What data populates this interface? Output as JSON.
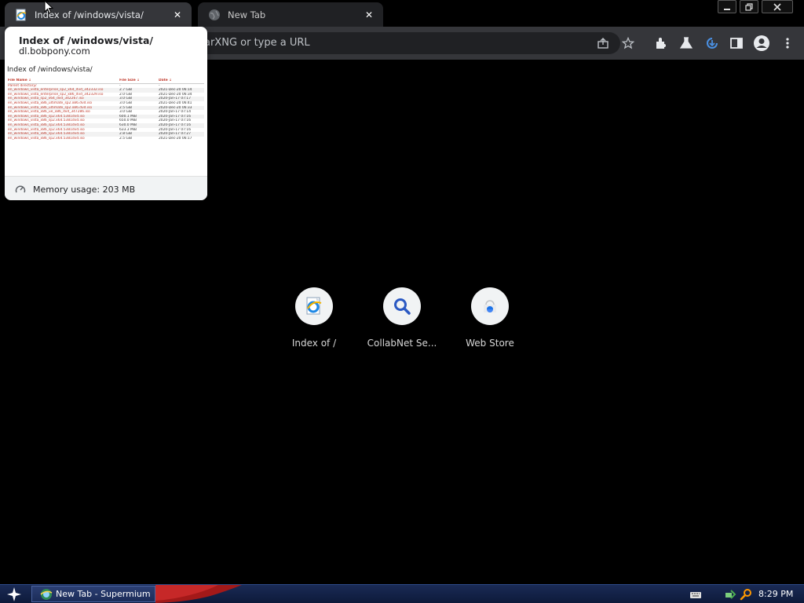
{
  "tabs": [
    {
      "title": "Index of /windows/vista/",
      "icon": "ie-page-icon",
      "active": true
    },
    {
      "title": "New Tab",
      "icon": "globe-icon",
      "active": false
    }
  ],
  "window_controls": {
    "minimize": "minimize-icon",
    "restore": "restore-icon",
    "close": "close-icon"
  },
  "omnibox": {
    "placeholder": "arXNG or type a URL"
  },
  "toolbar_icons": [
    "share-icon",
    "star-icon",
    "extensions-icon",
    "flask-icon",
    "download-icon",
    "side-panel-icon",
    "profile-icon",
    "menu-icon"
  ],
  "hover_card": {
    "title": "Index of /windows/vista/",
    "domain": "dl.bobpony.com",
    "memory": "Memory usage: 203 MB",
    "preview": {
      "heading": "Index of /windows/vista/",
      "columns": [
        "File Name ↓",
        "File Size ↓",
        "Date ↓"
      ],
      "rows": [
        [
          "Parent directory/",
          "-",
          "-"
        ],
        [
          "en_windows_vista_enterprise_sp2_x64_dvd_342332.iso",
          "2.7 GiB",
          "2021-Dec-20 06:14"
        ],
        [
          "en_windows_vista_enterprise_sp2_x86_dvd_342329.iso",
          "2.0 GiB",
          "2021-Dec-20 06:34"
        ],
        [
          "en_windows_vista_sp2_x64_dvd_342267.iso",
          "3.0 GiB",
          "2020-Jan-17 07:17"
        ],
        [
          "en_windows_vista_x86_ultimate_sp2.x86.dvd.iso",
          "3.0 GiB",
          "2021-Dec-20 06:41"
        ],
        [
          "en_windows_vista_x86_ultimate_sp2.x86.dvd.iso",
          "2.5 GiB",
          "2020-Dec-20 06:33"
        ],
        [
          "en_windows_vista_x86_ue_x86_dvd_347286.iso",
          "3.0 GiB",
          "2020-Jan-17 07:14"
        ],
        [
          "en_windows_vista_x86_sp2.x64.5381dvd.iso",
          "600.1 MiB",
          "2020-Jan-17 07:16"
        ],
        [
          "en_windows_vista_x86_sp2.x64.5381dvd.iso",
          "650.0 MiB",
          "2020-Jan-17 07:16"
        ],
        [
          "en_windows_vista_x86_sp2.x64.5381dvd.iso",
          "630.0 MiB",
          "2020-Jan-17 07:16"
        ],
        [
          "en_windows_vista_x86_sp2.x64.5381dvd.iso",
          "633.3 MiB",
          "2020-Jan-17 07:16"
        ],
        [
          "en_windows_vista_x86_sp2.x64.5381dvd.iso",
          "2.8 GiB",
          "2020-Jan-17 07:27"
        ],
        [
          "en_windows_vista_x86_sp2.x64.5381dvd.iso",
          "2.5 GiB",
          "2021-Dec-20 06:17"
        ]
      ]
    }
  },
  "shortcuts": [
    {
      "label": "Index of /",
      "icon": "ie-page-icon"
    },
    {
      "label": "CollabNet Se...",
      "icon": "search-icon"
    },
    {
      "label": "Web Store",
      "icon": "web-store-icon"
    }
  ],
  "taskbar": {
    "start_icon": "start-star-icon",
    "task_label": "New Tab - Supermium",
    "clock": "8:29 PM",
    "tray_icons": [
      "keyboard-icon",
      "network-icon",
      "search-tray-icon"
    ]
  }
}
